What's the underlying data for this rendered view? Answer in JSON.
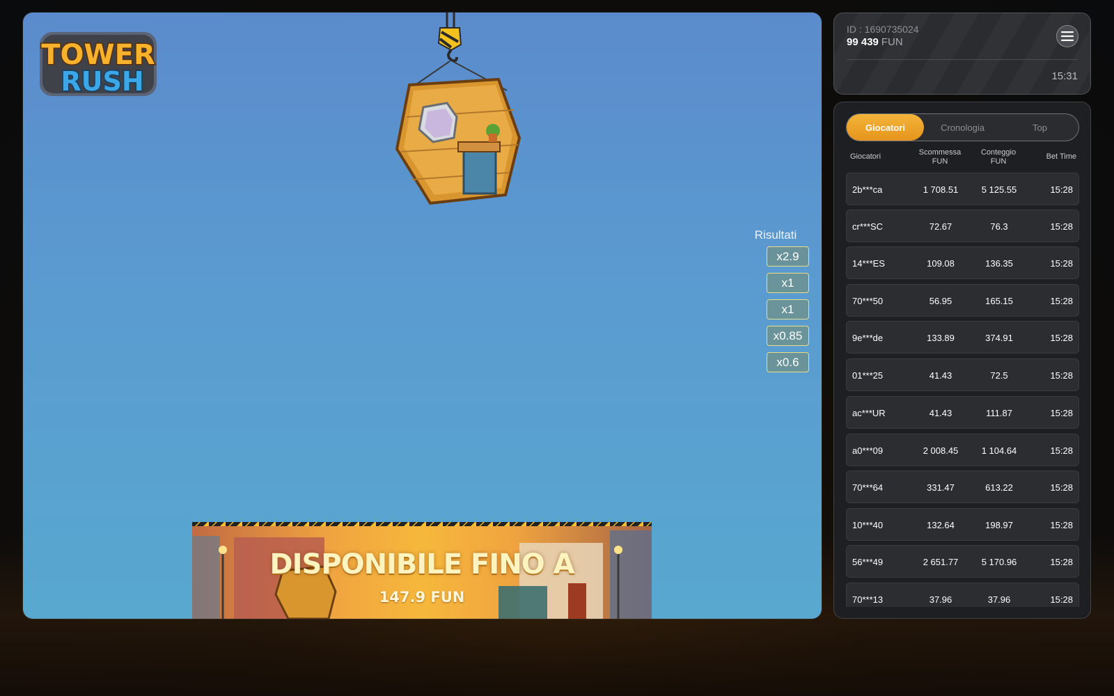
{
  "game": {
    "logo": {
      "line1": "TOWER",
      "line2": "RUSH"
    },
    "results": {
      "title": "Risultati",
      "values": [
        "x2.9",
        "x1",
        "x1",
        "x0.85",
        "x0.6"
      ]
    },
    "banner": {
      "title": "DISPONIBILE FINO A",
      "amount": "147.9 FUN"
    }
  },
  "account": {
    "id": "ID : 1690735024",
    "balance": "99 439",
    "currency": "FUN",
    "time": "15:31",
    "menu_icon": "hamburger-icon"
  },
  "players": {
    "tabs": [
      {
        "label": "Giocatori",
        "active": true
      },
      {
        "label": "Cronologia",
        "active": false
      },
      {
        "label": "Top",
        "active": false
      }
    ],
    "columns": {
      "player": "Giocatori",
      "bet_l1": "Scommessa",
      "bet_l2": "FUN",
      "count_l1": "Conteggio",
      "count_l2": "FUN",
      "time": "Bet Time"
    },
    "rows": [
      {
        "name": "2b***ca",
        "bet": "1 708.51",
        "count": "5 125.55",
        "time": "15:28"
      },
      {
        "name": "cr***SC",
        "bet": "72.67",
        "count": "76.3",
        "time": "15:28"
      },
      {
        "name": "14***ES",
        "bet": "109.08",
        "count": "136.35",
        "time": "15:28"
      },
      {
        "name": "70***50",
        "bet": "56.95",
        "count": "165.15",
        "time": "15:28"
      },
      {
        "name": "9e***de",
        "bet": "133.89",
        "count": "374.91",
        "time": "15:28"
      },
      {
        "name": "01***25",
        "bet": "41.43",
        "count": "72.5",
        "time": "15:28"
      },
      {
        "name": "ac***UR",
        "bet": "41.43",
        "count": "111.87",
        "time": "15:28"
      },
      {
        "name": "a0***09",
        "bet": "2 008.45",
        "count": "1 104.64",
        "time": "15:28"
      },
      {
        "name": "70***64",
        "bet": "331.47",
        "count": "613.22",
        "time": "15:28"
      },
      {
        "name": "10***40",
        "bet": "132.64",
        "count": "198.97",
        "time": "15:28"
      },
      {
        "name": "56***49",
        "bet": "2 651.77",
        "count": "5 170.96",
        "time": "15:28"
      },
      {
        "name": "70***13",
        "bet": "37.96",
        "count": "37.96",
        "time": "15:28"
      }
    ]
  }
}
